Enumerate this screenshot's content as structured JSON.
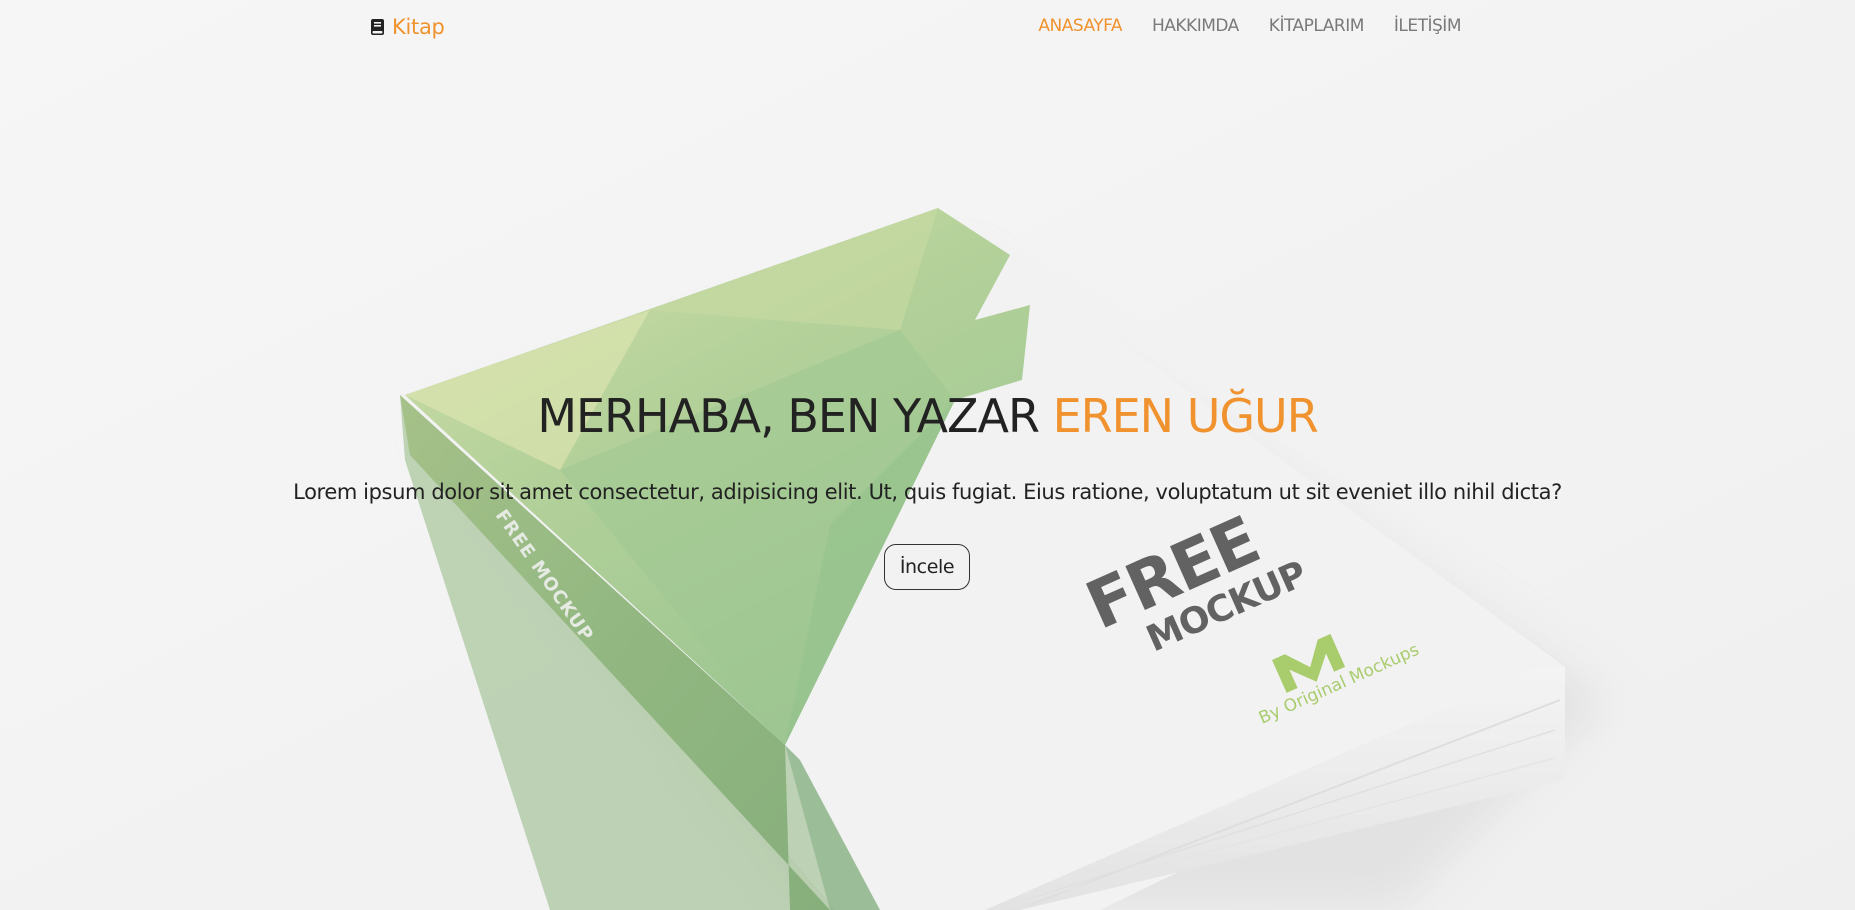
{
  "navbar": {
    "brand": "Kitap",
    "brand_icon": "book-icon",
    "items": [
      {
        "label": "ANASAYFA",
        "active": true
      },
      {
        "label": "HAKKIMDA",
        "active": false
      },
      {
        "label": "KİTAPLARIM",
        "active": false
      },
      {
        "label": "İLETİŞİM",
        "active": false
      }
    ]
  },
  "hero": {
    "title_main": "MERHABA, BEN YAZAR ",
    "title_accent": "EREN UĞUR",
    "subtitle": "Lorem ipsum dolor sit amet consectetur, adipisicing elit. Ut, quis fugiat. Eius ratione, voluptatum ut sit eveniet illo nihil dicta?",
    "button_label": "İncele"
  },
  "book_mockup": {
    "cover_line1": "FREE",
    "cover_line2": "MOCKUP",
    "logo_letter": "M",
    "byline": "By Original Mockups",
    "spine_text": "FREE MOCKUP"
  },
  "colors": {
    "accent": "#f0922e",
    "text": "#222222",
    "nav_text": "#7a7a7a",
    "green": "#8cc04b"
  }
}
